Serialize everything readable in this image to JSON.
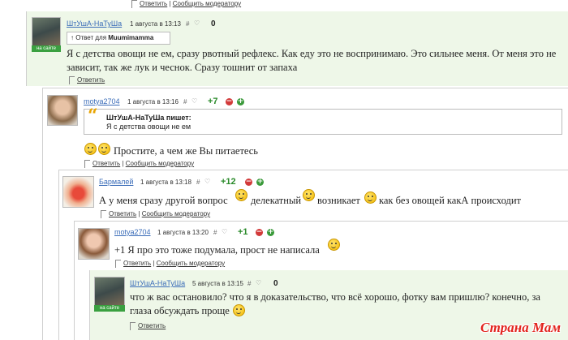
{
  "top": {
    "reply": "Ответить",
    "report": "Сообщить модератору"
  },
  "comments": [
    {
      "user": "ШтУшА-НаТуШа",
      "date": "1 августа в 13:13",
      "hash": "#",
      "score": "0",
      "online": "на сайте",
      "reply_to_prefix": "Ответ для",
      "reply_to_user": "Muumimamma",
      "text": "Я с детства овощи не ем, сразу рвотный рефлекс. Как еду это не воспринимаю. Это сильнее меня. От меня это не зависит, так же лук и чеснок. Сразу тошнит от запаха",
      "reply": "Ответить"
    },
    {
      "user": "motya2704",
      "date": "1 августа в 13:16",
      "hash": "#",
      "score": "+7",
      "quote_author": "ШтУшА-НаТуШа пишет:",
      "quote_text": "Я с детства овощи не ем",
      "text": "Простите, а чем же Вы питаетесь",
      "reply": "Ответить",
      "report": "Сообщить модератору"
    },
    {
      "user": "Бармалей",
      "date": "1 августа в 13:18",
      "hash": "#",
      "score": "+12",
      "text_1": "А у меня сразу другой вопрос",
      "text_2": "делекатный",
      "text_3": "возникает",
      "text_4": "как без овощей какА происходит",
      "reply": "Ответить",
      "report": "Сообщить модератору"
    },
    {
      "user": "motya2704",
      "date": "1 августа в 13:20",
      "hash": "#",
      "score": "+1",
      "text": "+1 Я про это тоже подумала, прост не написала",
      "reply": "Ответить",
      "report": "Сообщить модератору"
    },
    {
      "user": "ШтУшА-НаТуШа",
      "date": "5 августа в 13:15",
      "hash": "#",
      "score": "0",
      "online": "на сайте",
      "text": "что ж вас остановило? что я в доказательство, что всё хорошо, фотку вам пришлю? конечно, за глаза обсуждать проще",
      "reply": "Ответить"
    }
  ],
  "watermark": "Страна Мам",
  "colors": {
    "username": "#3a6cb8",
    "positive": "#2a8a2a",
    "minus": "#d23a3a",
    "plus": "#3a9a3a",
    "online": "#3aa040",
    "highlight_bg": "#eef7e8"
  }
}
